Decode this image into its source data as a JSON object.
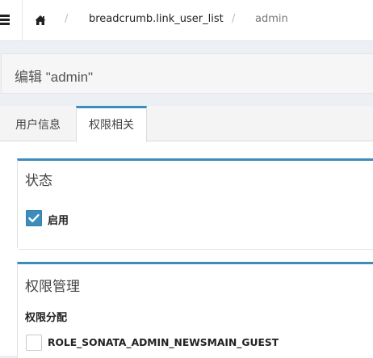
{
  "breadcrumb": {
    "separator": "/",
    "link_text": "breadcrumb.link_user_list",
    "current": "admin"
  },
  "page": {
    "title": "编辑 \"admin\""
  },
  "tabs": [
    {
      "label": "用户信息",
      "active": false
    },
    {
      "label": "权限相关",
      "active": true
    }
  ],
  "status_section": {
    "title": "状态",
    "enabled_label": "启用",
    "enabled_checked": true
  },
  "permissions_section": {
    "title": "权限管理",
    "assign_label": "权限分配",
    "roles": [
      {
        "label": "ROLE_SONATA_ADMIN_NEWSMAIN_GUEST",
        "checked": false
      }
    ]
  },
  "colors": {
    "accent": "#3c8dbc",
    "background": "#ecf0f5"
  },
  "icons": {
    "menu": "hamburger-icon",
    "home": "home-icon",
    "check": "checkmark-icon"
  }
}
